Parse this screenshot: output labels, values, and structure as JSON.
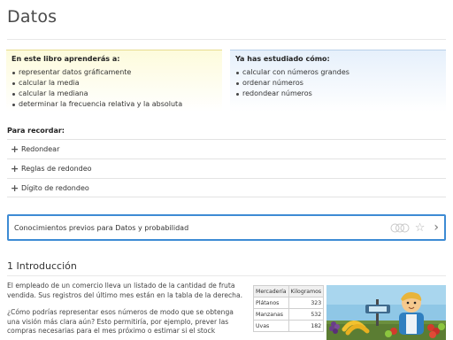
{
  "page": {
    "title": "Datos"
  },
  "learn_box": {
    "heading": "En este libro aprenderás a:",
    "items": [
      "representar datos gráficamente",
      "calcular la media",
      "calcular la mediana",
      "determinar la frecuencia relativa y la absoluta"
    ]
  },
  "studied_box": {
    "heading": "Ya has estudiado cómo:",
    "items": [
      "calcular con números grandes",
      "ordenar números",
      "redondear números"
    ]
  },
  "recall": {
    "heading": "Para recordar:",
    "items": [
      {
        "label": "Redondear"
      },
      {
        "label": "Reglas de redondeo"
      },
      {
        "label": "Dígito de redondeo"
      }
    ]
  },
  "prior_knowledge": {
    "label": "Conocimientos previos para Datos y probabilidad"
  },
  "intro": {
    "title": "1 Introducción",
    "para1": "El empleado de un comercio lleva un listado de la cantidad de fruta vendida. Sus registros del último mes están en la tabla de la derecha.",
    "para2": "¿Cómo podrías representar esos números de modo que se obtenga una visión más clara aún? Esto permitiría, por ejemplo, prever las compras necesarias para el mes próximo o estimar si el stock"
  },
  "fruit_table": {
    "headers": [
      "Mercadería",
      "Kilogramos"
    ],
    "rows": [
      [
        "Plátanos",
        "323"
      ],
      [
        "Manzanas",
        "532"
      ],
      [
        "Uvas",
        "182"
      ]
    ]
  },
  "colors": {
    "accent": "#3d8bd4",
    "learn_bg": "#fdfbdc",
    "studied_bg": "#e6f0fb"
  }
}
